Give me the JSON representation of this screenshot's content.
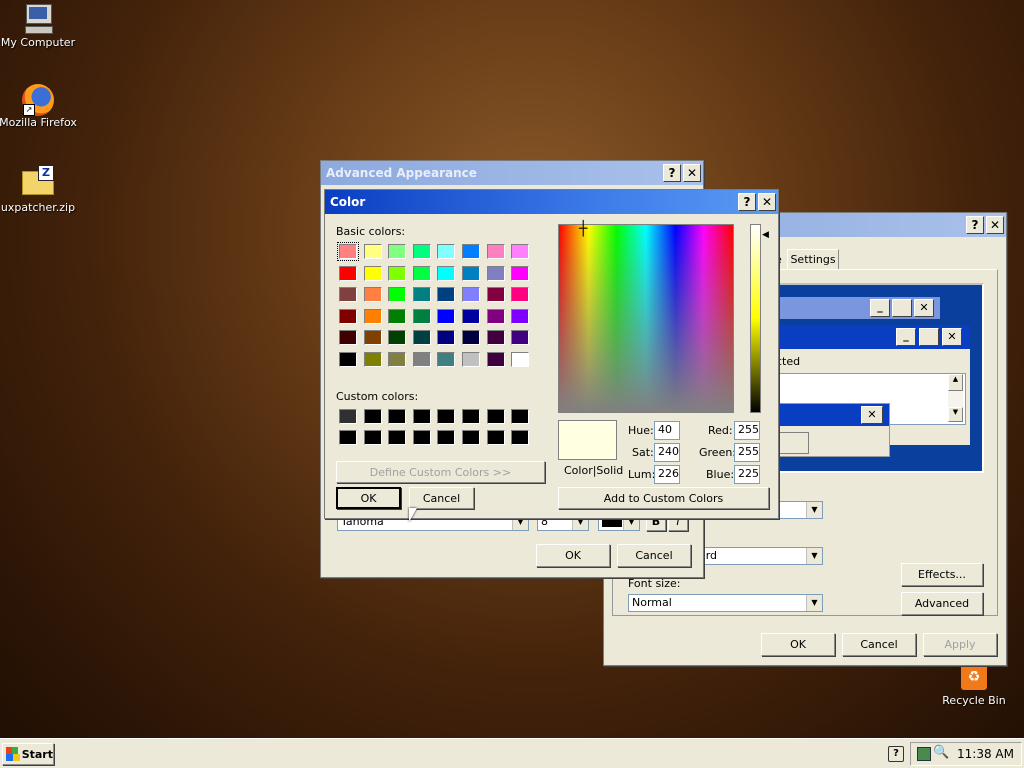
{
  "desktop": {
    "icons": [
      {
        "label": "My Computer"
      },
      {
        "label": "Mozilla Firefox"
      },
      {
        "label": "uxpatcher.zip"
      },
      {
        "label": "Recycle Bin"
      }
    ]
  },
  "display_props": {
    "tab_settings": "Settings",
    "tab_partial": "e",
    "preview_text": "cted",
    "font_size_label": "Font size:",
    "font_size_value": "Normal",
    "scheme_partial": "dard",
    "effects_button": "Effects...",
    "advanced_button": "Advanced",
    "ok": "OK",
    "cancel": "Cancel",
    "apply": "Apply"
  },
  "advanced": {
    "title": "Advanced Appearance",
    "font_value": "Tahoma",
    "font_size": "8",
    "bold": "B",
    "italic": "I",
    "ok": "OK",
    "cancel": "Cancel"
  },
  "color_dialog": {
    "title": "Color",
    "basic_colors_label": "Basic colors:",
    "custom_colors_label": "Custom colors:",
    "define_custom": "Define Custom Colors >>",
    "ok": "OK",
    "cancel": "Cancel",
    "color_solid_label": "Color|Solid",
    "hue_label": "Hue:",
    "hue": "40",
    "sat_label": "Sat:",
    "sat": "240",
    "lum_label": "Lum:",
    "lum": "226",
    "red_label": "Red:",
    "red": "255",
    "green_label": "Green:",
    "green": "255",
    "blue_label": "Blue:",
    "blue": "225",
    "add_custom": "Add to Custom Colors",
    "current_color": "#ffffe1",
    "basic_colors": [
      "#ff8080",
      "#ffff80",
      "#80ff80",
      "#00ff80",
      "#80ffff",
      "#0080ff",
      "#ff80c0",
      "#ff80ff",
      "#ff0000",
      "#ffff00",
      "#80ff00",
      "#00ff40",
      "#00ffff",
      "#0080c0",
      "#8080c0",
      "#ff00ff",
      "#804040",
      "#ff8040",
      "#00ff00",
      "#008080",
      "#004080",
      "#8080ff",
      "#800040",
      "#ff0080",
      "#800000",
      "#ff8000",
      "#008000",
      "#008040",
      "#0000ff",
      "#0000a0",
      "#800080",
      "#8000ff",
      "#400000",
      "#804000",
      "#004000",
      "#004040",
      "#000080",
      "#000040",
      "#400040",
      "#400080",
      "#000000",
      "#808000",
      "#808040",
      "#808080",
      "#408080",
      "#c0c0c0",
      "#400040",
      "#ffffff"
    ]
  },
  "taskbar": {
    "start": "Start",
    "clock": "11:38 AM"
  }
}
